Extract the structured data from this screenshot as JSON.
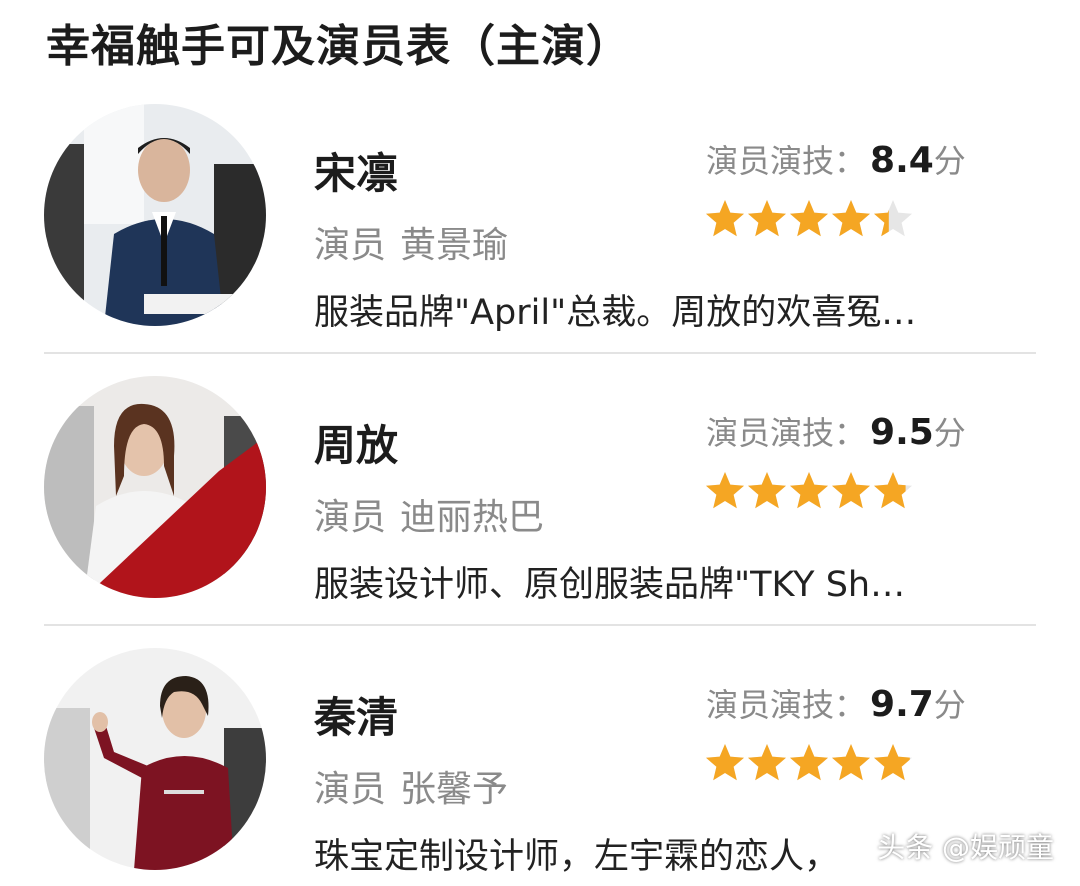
{
  "page_title": "幸福触手可及演员表（主演）",
  "rating_prefix": "演员演技：",
  "rating_suffix": "分",
  "actor_prefix": "演员",
  "cast": [
    {
      "role": "宋凛",
      "actor": "黄景瑜",
      "score": "8.4",
      "stars": 4.4,
      "description": "服装品牌\"April\"总裁。周放的欢喜冤…"
    },
    {
      "role": "周放",
      "actor": "迪丽热巴",
      "score": "9.5",
      "stars": 4.8,
      "description": "服装设计师、原创服装品牌\"TKY Sh…"
    },
    {
      "role": "秦清",
      "actor": "张馨予",
      "score": "9.7",
      "stars": 4.9,
      "description": "珠宝定制设计师，左宇霖的恋人，"
    }
  ],
  "watermark": "头条 @娱顽童",
  "colors": {
    "star_filled": "#f5a623",
    "star_empty": "#e6e6e6",
    "divider": "#e3e3e3"
  }
}
